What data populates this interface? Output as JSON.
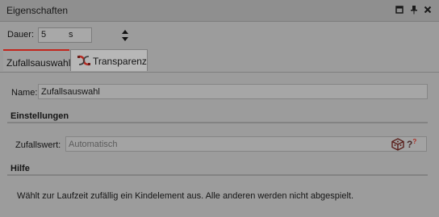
{
  "window": {
    "title": "Eigenschaften"
  },
  "icons": {
    "maximize": "maximize-icon",
    "pin": "pin-icon",
    "close": "close-icon",
    "spinner": "spinner-up-down-icon",
    "transparency": "transparency-effect-icon",
    "variable": "cube-variable-icon",
    "help": "random-help-icon"
  },
  "dauer": {
    "label": "Dauer:",
    "value": "5",
    "unit": "s"
  },
  "tabs": [
    {
      "label": "Zufallsauswahl",
      "active": true
    },
    {
      "label": "Transparenz",
      "active": false
    }
  ],
  "name": {
    "label": "Name:",
    "value": "Zufallsauswahl"
  },
  "einstellungen": {
    "heading": "Einstellungen",
    "zufallswert": {
      "label": "Zufallswert:",
      "placeholder": "Automatisch",
      "help_glyph": "?",
      "help_sup": "?"
    }
  },
  "hilfe": {
    "heading": "Hilfe",
    "text": "Wählt zur Laufzeit zufällig ein Kindelement aus. Alle anderen werden nicht abgespielt."
  },
  "colors": {
    "background": "#9c9c9c",
    "accent": "#c2261d",
    "field": "#a6a6a6"
  }
}
